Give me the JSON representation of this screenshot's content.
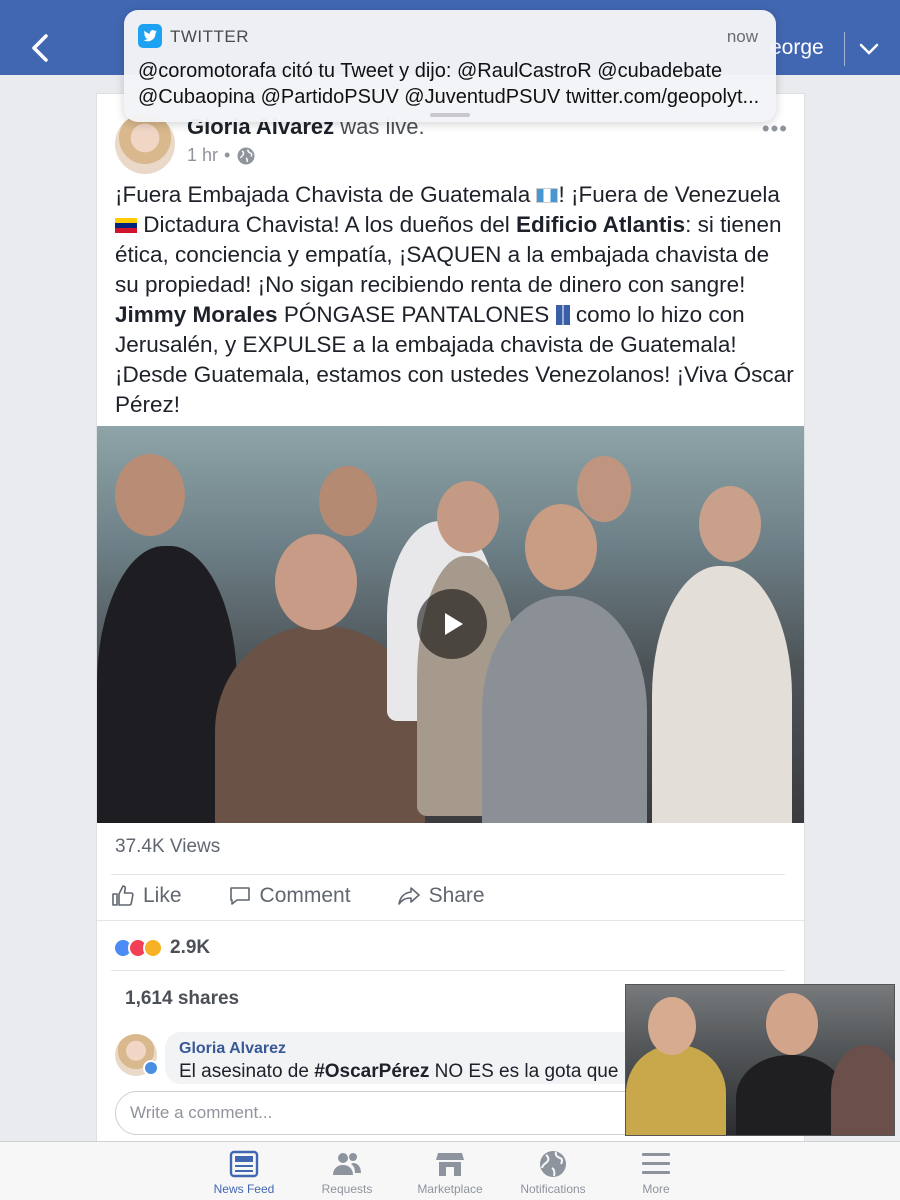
{
  "topbar": {
    "name": "eorge"
  },
  "notification": {
    "app": "TWITTER",
    "time": "now",
    "line1": "@coromotorafa citó tu Tweet y dijo: @RaulCastroR @cubadebate",
    "line2": "@Cubaopina @PartidoPSUV @JuventudPSUV twitter.com/geopolyt..."
  },
  "post": {
    "author": "Gloria Alvarez",
    "action": "was live.",
    "time": "1 hr",
    "dot": "•",
    "text": {
      "p1": "¡Fuera Embajada Chavista de Guatemala ",
      "p2": "! ¡Fuera de Venezuela ",
      "p3": " Dictadura Chavista! A los dueños del ",
      "b1": "Edificio Atlantis",
      "p4": ": si tienen ética, conciencia y empatía, ¡SAQUEN a la embajada chavista de su propiedad! ¡No sigan recibiendo renta de dinero con sangre!",
      "b2": "Jimmy Morales",
      "p5": " PÓNGASE PANTALONES ",
      "p6": " como lo hizo con Jerusalén, y EXPULSE a la embajada chavista de Guatemala! ¡Desde Guatemala, estamos con ustedes Venezolanos! ¡Viva Óscar Pérez!"
    },
    "views": "37.4K Views",
    "actions": {
      "like": "Like",
      "comment": "Comment",
      "share": "Share"
    },
    "reactions_count": "2.9K",
    "shares": "1,614 shares",
    "comment": {
      "author": "Gloria Alvarez",
      "text_pre": "El asesinato de ",
      "hashtag": "#OscarPérez",
      "text_post": " NO ES es la gota que re"
    },
    "write_placeholder": "Write a comment..."
  },
  "tabs": [
    {
      "label": "News Feed",
      "icon": "news-feed-icon",
      "active": true
    },
    {
      "label": "Requests",
      "icon": "friend-requests-icon",
      "active": false
    },
    {
      "label": "Marketplace",
      "icon": "marketplace-icon",
      "active": false
    },
    {
      "label": "Notifications",
      "icon": "globe-icon",
      "active": false
    },
    {
      "label": "More",
      "icon": "menu-icon",
      "active": false
    }
  ],
  "colors": {
    "brand": "#4267b2",
    "twitter": "#1da1f2"
  }
}
